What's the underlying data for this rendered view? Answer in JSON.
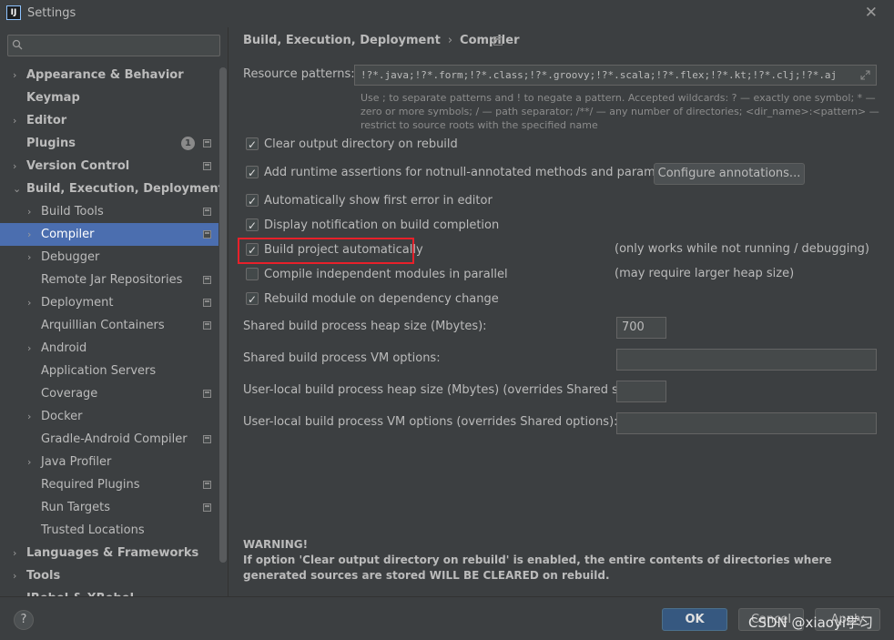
{
  "window": {
    "title": "Settings",
    "close": "✕",
    "app_icon_text": "IJ"
  },
  "sidebar": {
    "search_placeholder": "",
    "items": [
      {
        "label": "Appearance & Behavior",
        "bold": true,
        "arrow": "›",
        "level": 0
      },
      {
        "label": "Keymap",
        "bold": true,
        "arrow": "",
        "level": 0
      },
      {
        "label": "Editor",
        "bold": true,
        "arrow": "›",
        "level": 0
      },
      {
        "label": "Plugins",
        "bold": true,
        "arrow": "",
        "level": 0,
        "badge": "1",
        "proj": true
      },
      {
        "label": "Version Control",
        "bold": true,
        "arrow": "›",
        "level": 0,
        "proj": true
      },
      {
        "label": "Build, Execution, Deployment",
        "bold": true,
        "arrow": "⌄",
        "level": 0
      },
      {
        "label": "Build Tools",
        "bold": false,
        "arrow": "›",
        "level": 1,
        "proj": true
      },
      {
        "label": "Compiler",
        "bold": false,
        "arrow": "›",
        "level": 1,
        "proj": true,
        "selected": true
      },
      {
        "label": "Debugger",
        "bold": false,
        "arrow": "›",
        "level": 1
      },
      {
        "label": "Remote Jar Repositories",
        "bold": false,
        "arrow": "",
        "level": 1,
        "proj": true
      },
      {
        "label": "Deployment",
        "bold": false,
        "arrow": "›",
        "level": 1,
        "proj": true
      },
      {
        "label": "Arquillian Containers",
        "bold": false,
        "arrow": "",
        "level": 1,
        "proj": true
      },
      {
        "label": "Android",
        "bold": false,
        "arrow": "›",
        "level": 1
      },
      {
        "label": "Application Servers",
        "bold": false,
        "arrow": "",
        "level": 1
      },
      {
        "label": "Coverage",
        "bold": false,
        "arrow": "",
        "level": 1,
        "proj": true
      },
      {
        "label": "Docker",
        "bold": false,
        "arrow": "›",
        "level": 1
      },
      {
        "label": "Gradle-Android Compiler",
        "bold": false,
        "arrow": "",
        "level": 1,
        "proj": true
      },
      {
        "label": "Java Profiler",
        "bold": false,
        "arrow": "›",
        "level": 1
      },
      {
        "label": "Required Plugins",
        "bold": false,
        "arrow": "",
        "level": 1,
        "proj": true
      },
      {
        "label": "Run Targets",
        "bold": false,
        "arrow": "",
        "level": 1,
        "proj": true
      },
      {
        "label": "Trusted Locations",
        "bold": false,
        "arrow": "",
        "level": 1
      },
      {
        "label": "Languages & Frameworks",
        "bold": true,
        "arrow": "›",
        "level": 0
      },
      {
        "label": "Tools",
        "bold": true,
        "arrow": "›",
        "level": 0
      },
      {
        "label": "JRebel & XRebel",
        "bold": true,
        "arrow": "›",
        "level": 0
      }
    ]
  },
  "main": {
    "breadcrumb": [
      "Build, Execution, Deployment",
      "Compiler"
    ],
    "breadcrumb_sep": "›",
    "resource_label": "Resource patterns:",
    "resource_value": "!?*.java;!?*.form;!?*.class;!?*.groovy;!?*.scala;!?*.flex;!?*.kt;!?*.clj;!?*.aj",
    "hint": "Use ; to separate patterns and ! to negate a pattern. Accepted wildcards: ? — exactly one symbol; * — zero or more symbols; / — path separator; /**/ — any number of directories; <dir_name>:<pattern> — restrict to source roots with the specified name",
    "checkboxes": [
      {
        "label": "Clear output directory on rebuild",
        "checked": true
      },
      {
        "label": "Add runtime assertions for notnull-annotated methods and parameters",
        "checked": true
      },
      {
        "label": "Automatically show first error in editor",
        "checked": true
      },
      {
        "label": "Display notification on build completion",
        "checked": true
      },
      {
        "label": "Build project automatically",
        "checked": true
      },
      {
        "label": "Compile independent modules in parallel",
        "checked": false
      },
      {
        "label": "Rebuild module on dependency change",
        "checked": true
      }
    ],
    "configure_button": "Configure annotations...",
    "note_auto_build": "(only works while not running / debugging)",
    "note_parallel": "(may require larger heap size)",
    "heap_label": "Shared build process heap size (Mbytes):",
    "heap_value": "700",
    "vm_label": "Shared build process VM options:",
    "vm_value": "",
    "local_heap_label": "User-local build process heap size (Mbytes) (overrides Shared size):",
    "local_heap_value": "",
    "local_vm_label": "User-local build process VM options (overrides Shared options):",
    "local_vm_value": "",
    "warning_title": "WARNING!",
    "warning_text": "If option 'Clear output directory on rebuild' is enabled, the entire contents of directories where generated sources are stored WILL BE CLEARED on rebuild."
  },
  "footer": {
    "help": "?",
    "ok": "OK",
    "cancel": "Cancel",
    "apply": "Apply",
    "watermark": "CSDN @xiaoyi学习"
  },
  "colors": {
    "selection": "#4b6eaf",
    "highlight_box": "#e8202a",
    "ok_button": "#365880",
    "background": "#3c3f41"
  }
}
